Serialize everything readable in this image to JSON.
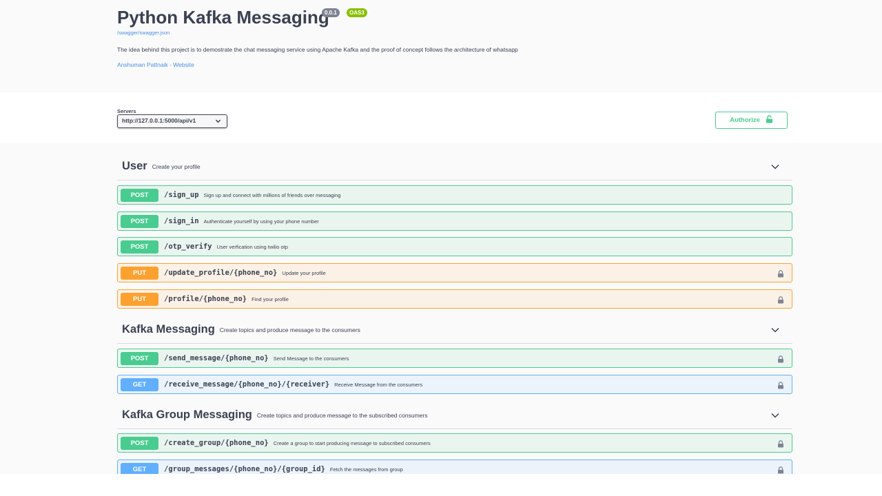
{
  "info": {
    "title": "Python Kafka Messaging",
    "version": "0.0.1",
    "oas_badge": "OAS3",
    "spec_link": "/swagger/swagger.json",
    "description": "The idea behind this project is to demostrate the chat messaging service using Apache Kafka and the proof of concept follows the architecture of whatsapp",
    "contact_link": "Anshuman Pattnaik - Website"
  },
  "servers": {
    "label": "Servers",
    "selected": "http://127.0.0.1:5000/api/v1"
  },
  "authorize": {
    "label": "Authorize"
  },
  "tags": [
    {
      "name": "User",
      "description": "Create your profile",
      "operations": [
        {
          "method": "POST",
          "path": "/sign_up",
          "summary": "Sign up and connect with millions of friends over messaging",
          "locked": false
        },
        {
          "method": "POST",
          "path": "/sign_in",
          "summary": "Authenticate yourself by using your phone number",
          "locked": false
        },
        {
          "method": "POST",
          "path": "/otp_verify",
          "summary": "User verfication using twilio otp",
          "locked": false
        },
        {
          "method": "PUT",
          "path": "/update_profile/{phone_no}",
          "summary": "Update your profile",
          "locked": true
        },
        {
          "method": "PUT",
          "path": "/profile/{phone_no}",
          "summary": "Find your profile",
          "locked": true
        }
      ]
    },
    {
      "name": "Kafka Messaging",
      "description": "Create topics and produce message to the consumers",
      "operations": [
        {
          "method": "POST",
          "path": "/send_message/{phone_no}",
          "summary": "Send Message to the consumers",
          "locked": true
        },
        {
          "method": "GET",
          "path": "/receive_message/{phone_no}/{receiver}",
          "summary": "Receive Message from the consumers",
          "locked": true
        }
      ]
    },
    {
      "name": "Kafka Group Messaging",
      "description": "Create topics and produce message to the subscribed consumers",
      "operations": [
        {
          "method": "POST",
          "path": "/create_group/{phone_no}",
          "summary": "Create a group to start producing message to subscribed consumers",
          "locked": true
        },
        {
          "method": "GET",
          "path": "/group_messages/{phone_no}/{group_id}",
          "summary": "Fetch the messages from group",
          "locked": true
        }
      ]
    }
  ],
  "colors": {
    "post": "#49cc90",
    "put": "#fca130",
    "get": "#61affe",
    "link": "#4990e2"
  }
}
